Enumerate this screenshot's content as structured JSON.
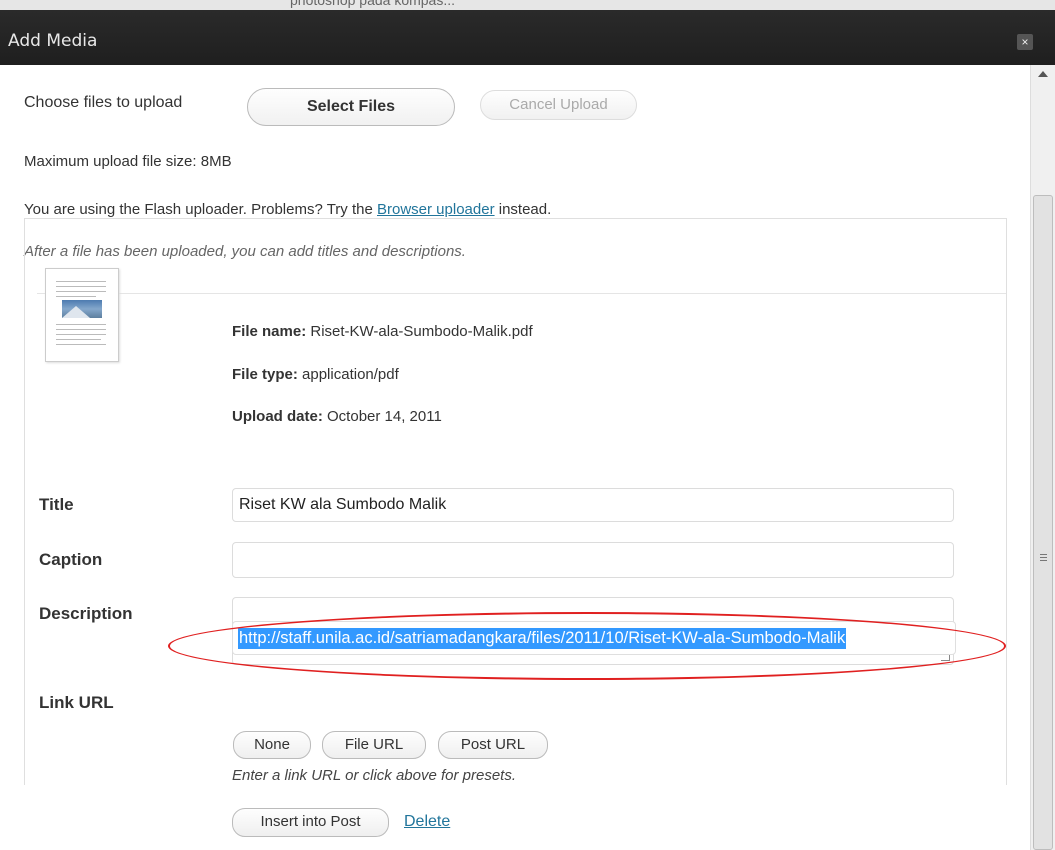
{
  "dialog": {
    "title": "Add Media",
    "close_label": "×",
    "background_strip_text": "photoshop pada kompas..."
  },
  "upload": {
    "choose_label": "Choose files to upload",
    "select_button": "Select Files",
    "cancel_button": "Cancel Upload",
    "max_size": "Maximum upload file size: 8MB",
    "flash_text": "You are using the Flash uploader. Problems? Try the",
    "browser_link": "Browser uploader",
    "flash_suffix": "instead.",
    "after_note": "After a file has been uploaded, you can add titles and descriptions."
  },
  "file": {
    "name_label": "File name:",
    "name_value": "Riset-KW-ala-Sumbodo-Malik.pdf",
    "type_label": "File type:",
    "type_value": "application/pdf",
    "date_label": "Upload date:",
    "date_value": "October 14, 2011"
  },
  "form": {
    "title_label": "Title",
    "title_value": "Riset KW ala Sumbodo Malik",
    "caption_label": "Caption",
    "caption_value": "",
    "description_label": "Description",
    "description_value": "",
    "link_label": "Link URL",
    "link_value": "http://staff.unila.ac.id/satriamadangkara/files/2011/10/Riset-KW-ala-Sumbodo-Malik",
    "none_button": "None",
    "file_url_button": "File URL",
    "post_url_button": "Post URL",
    "link_help": "Enter a link URL or click above for presets.",
    "insert_button": "Insert into Post",
    "delete_link": "Delete"
  },
  "colors": {
    "titlebar": "#222222",
    "selection": "#3399ff",
    "highlight_ellipse": "#e02020",
    "link": "#21759b"
  }
}
